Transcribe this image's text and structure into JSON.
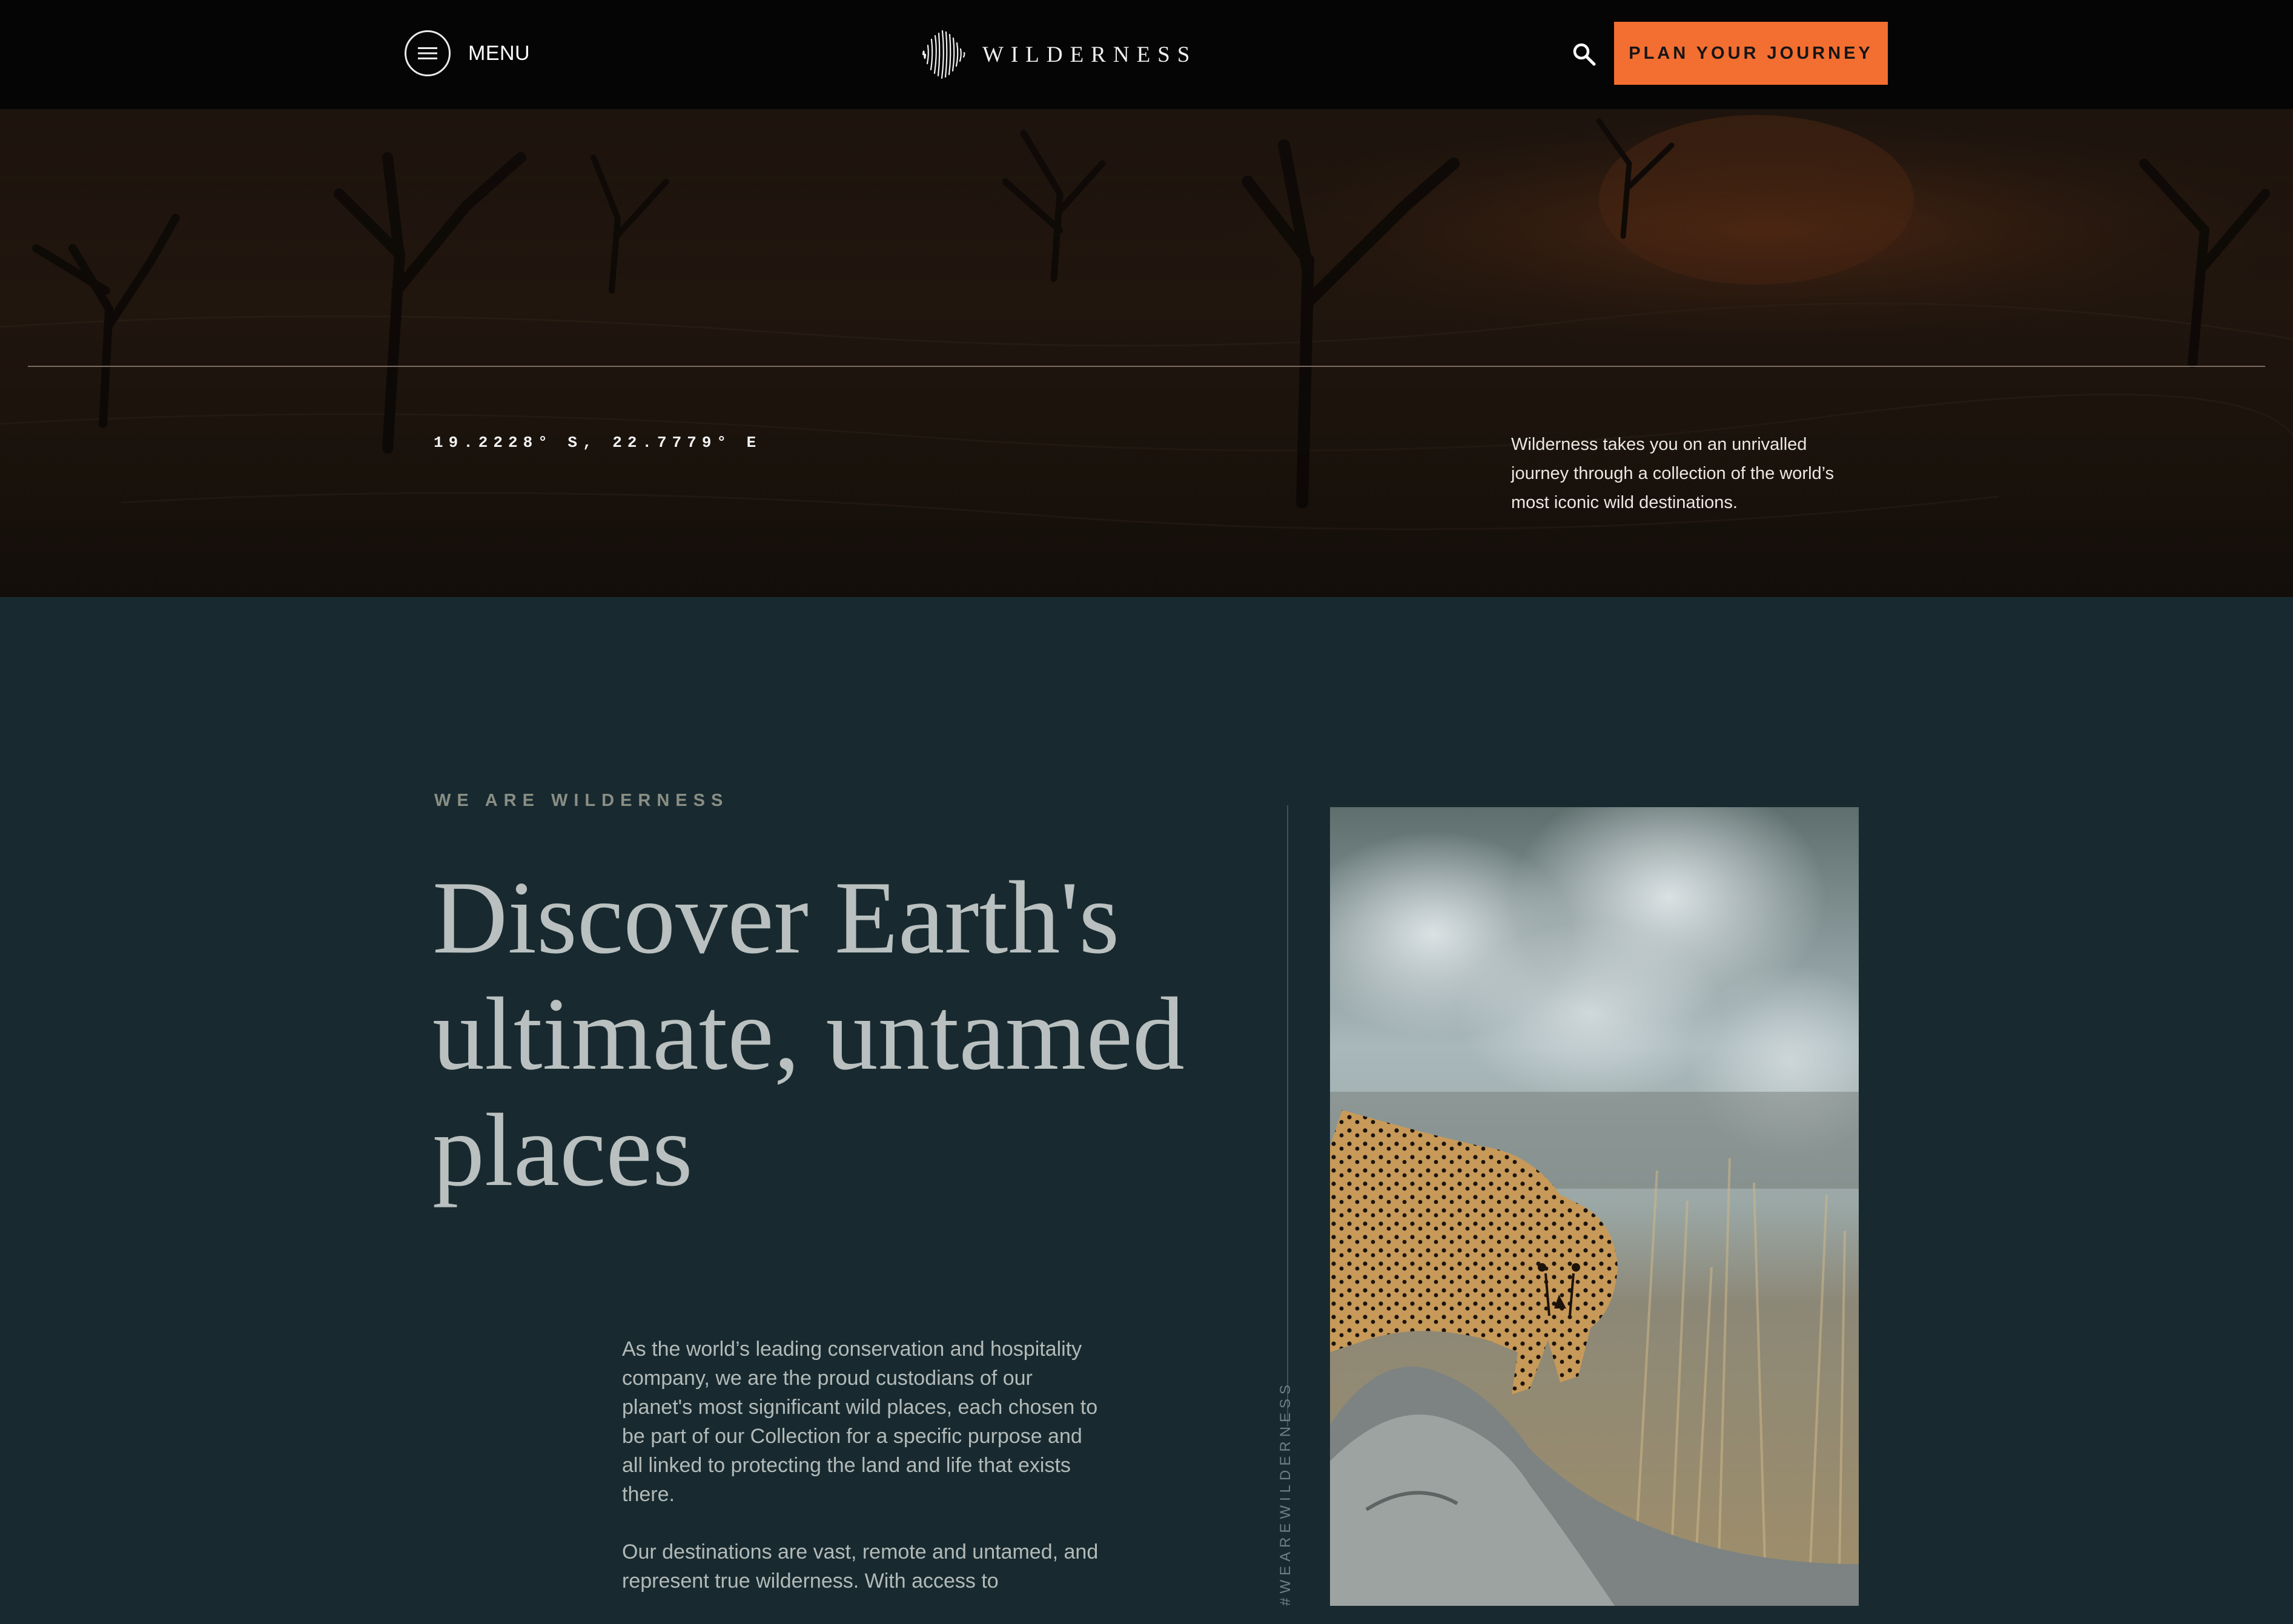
{
  "header": {
    "menu_label": "MENU",
    "logo_text": "WILDERNESS",
    "search_icon": "search-icon",
    "cta_label": "PLAN YOUR JOURNEY",
    "cta_color": "#f36e31"
  },
  "hero": {
    "coordinates": "19.2228° S, 22.7779° E",
    "intro": "Wilderness takes you on an unrivalled journey through a collection of the world’s most iconic wild destinations."
  },
  "intro_section": {
    "eyebrow": "WE ARE WILDERNESS",
    "headline": "Discover Earth's ultimate, untamed places",
    "paragraphs": [
      "As the world’s leading conservation and hospitality company, we are the proud custodians of our planet's most significant wild places, each chosen to be part of our Collection for a specific purpose and all linked to protecting the land and life that exists there.",
      "Our destinations are vast, remote and untamed, and represent true wilderness. With access to"
    ],
    "vertical_tag": "#WEAREWILDERNESS",
    "image": "cheetah-photo",
    "background_color": "#182a30"
  }
}
